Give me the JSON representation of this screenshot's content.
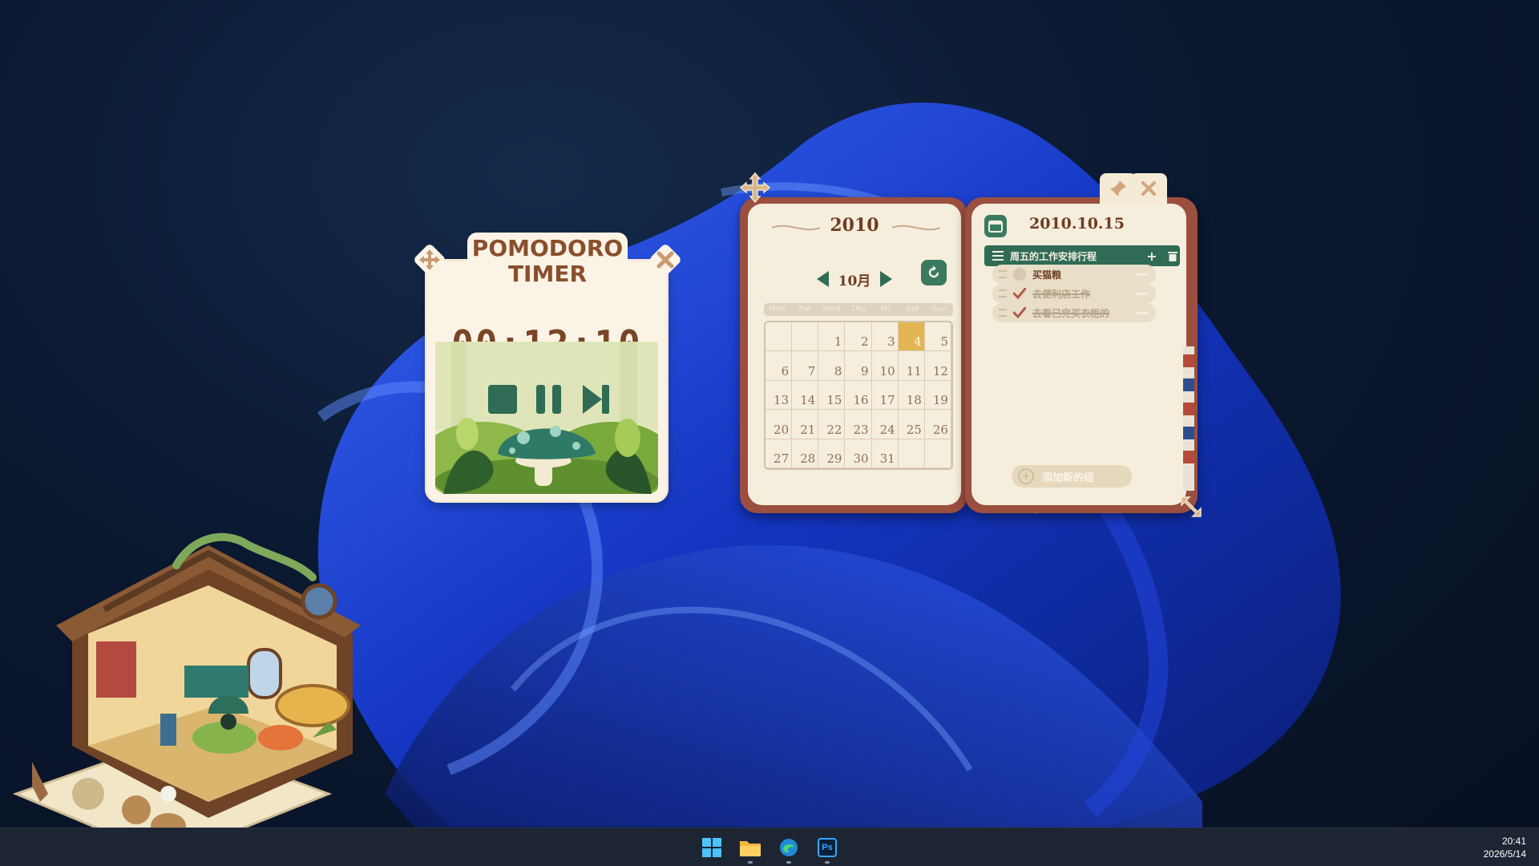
{
  "pomodoro": {
    "title_line1": "POMODORO",
    "title_line2": "TIMER",
    "time": "00:12:10",
    "icons": [
      "move-icon",
      "close-icon",
      "stop-icon",
      "pause-icon",
      "skip-next-icon"
    ]
  },
  "calendar": {
    "year": "2010",
    "month": "10月",
    "weekdays": [
      "Mon",
      "Tue",
      "Wed",
      "Thu",
      "Fri",
      "Sat",
      "Sun"
    ],
    "days": [
      "",
      "",
      "1",
      "2",
      "3",
      "4",
      "5",
      "6",
      "7",
      "8",
      "9",
      "10",
      "11",
      "12",
      "13",
      "14",
      "15",
      "16",
      "17",
      "18",
      "19",
      "20",
      "21",
      "22",
      "23",
      "24",
      "25",
      "26",
      "27",
      "28",
      "29",
      "30",
      "31",
      "",
      ""
    ],
    "highlighted_day": "4",
    "highlight_color": "#e2b552"
  },
  "todo": {
    "date": "2010.10.15",
    "group_title": "周五的工作安排行程",
    "group_add": "+",
    "items": [
      {
        "text": "买猫粮",
        "done": false
      },
      {
        "text": "去便利店工作",
        "done": true
      },
      {
        "text": "去看已完买衣柜的",
        "done": true
      }
    ],
    "add_group_label": "添加新的组"
  },
  "taskbar": {
    "icons": [
      "windows-start-icon",
      "file-explorer-icon",
      "edge-browser-icon",
      "photoshop-icon"
    ],
    "photoshop_label": "Ps",
    "clock_time": "20:41",
    "clock_date": "2026/5/14"
  },
  "colors": {
    "accent_green": "#2f6b55",
    "book_border": "#9b4f3e",
    "paper": "#f6eedc",
    "title_brown": "#8a4f2d"
  }
}
